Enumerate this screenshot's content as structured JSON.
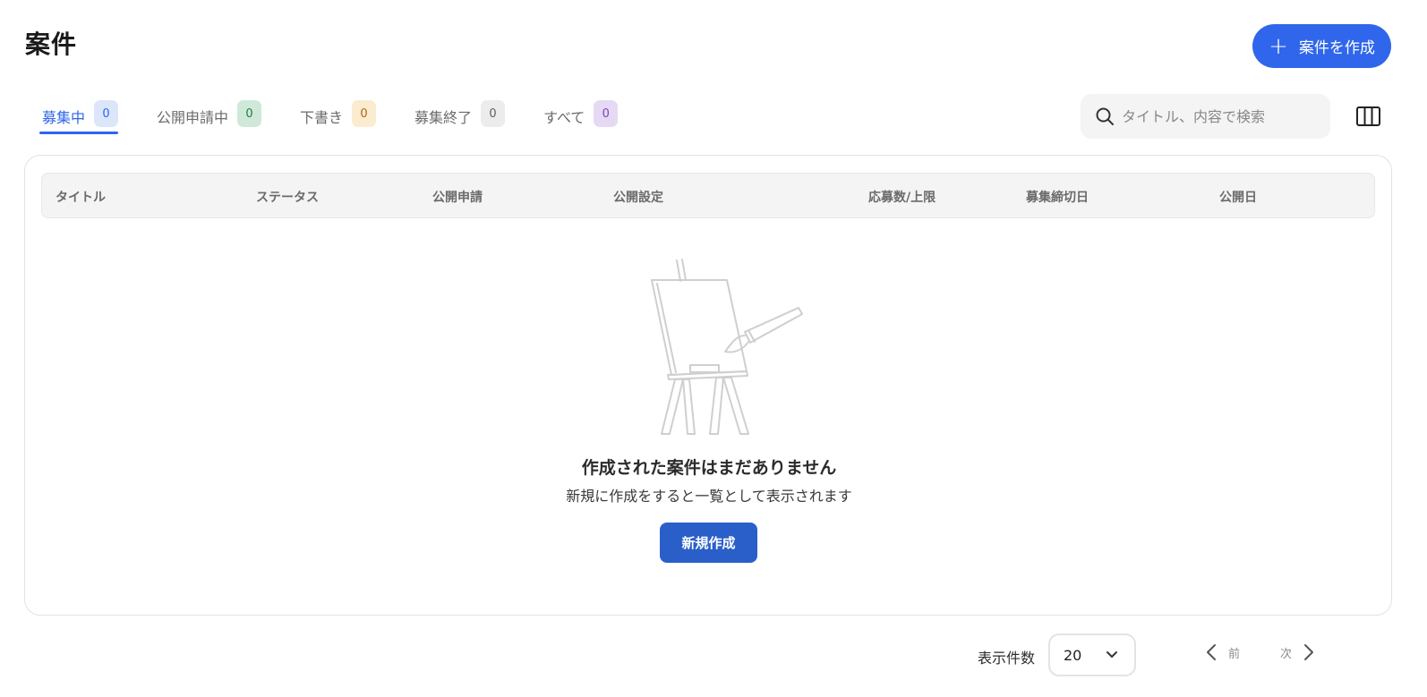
{
  "header": {
    "title": "案件",
    "create_button_label": "案件を作成",
    "create_button_icon": "plus-icon"
  },
  "tabs": [
    {
      "label": "募集中",
      "count": "0",
      "active": true,
      "color": "#2f66eb"
    },
    {
      "label": "公開申請中",
      "count": "0",
      "active": false,
      "color": "#2a7a48"
    },
    {
      "label": "下書き",
      "count": "0",
      "active": false,
      "color": "#a86b13"
    },
    {
      "label": "募集終了",
      "count": "0",
      "active": false,
      "color": "#606060"
    },
    {
      "label": "すべて",
      "count": "0",
      "active": false,
      "color": "#7b46b8"
    }
  ],
  "search": {
    "placeholder": "タイトル、内容で検索",
    "value": "",
    "icon": "search-icon"
  },
  "toolbar": {
    "columns_icon": "columns-icon"
  },
  "table": {
    "columns": [
      "タイトル",
      "ステータス",
      "公開申請",
      "公開設定",
      "応募数/上限",
      "募集締切日",
      "公開日"
    ],
    "rows": []
  },
  "empty_state": {
    "illustration": "easel-paintbrush-illustration",
    "title": "作成された案件はまだありません",
    "description": "新規に作成をすると一覧として表示されます",
    "button_label": "新規作成"
  },
  "pagination": {
    "per_page_label": "表示件数",
    "per_page_value": "20",
    "prev_label": "前",
    "next_label": "次"
  },
  "colors": {
    "primary": "#2f66eb",
    "primary_dark": "#2a5fc9"
  }
}
